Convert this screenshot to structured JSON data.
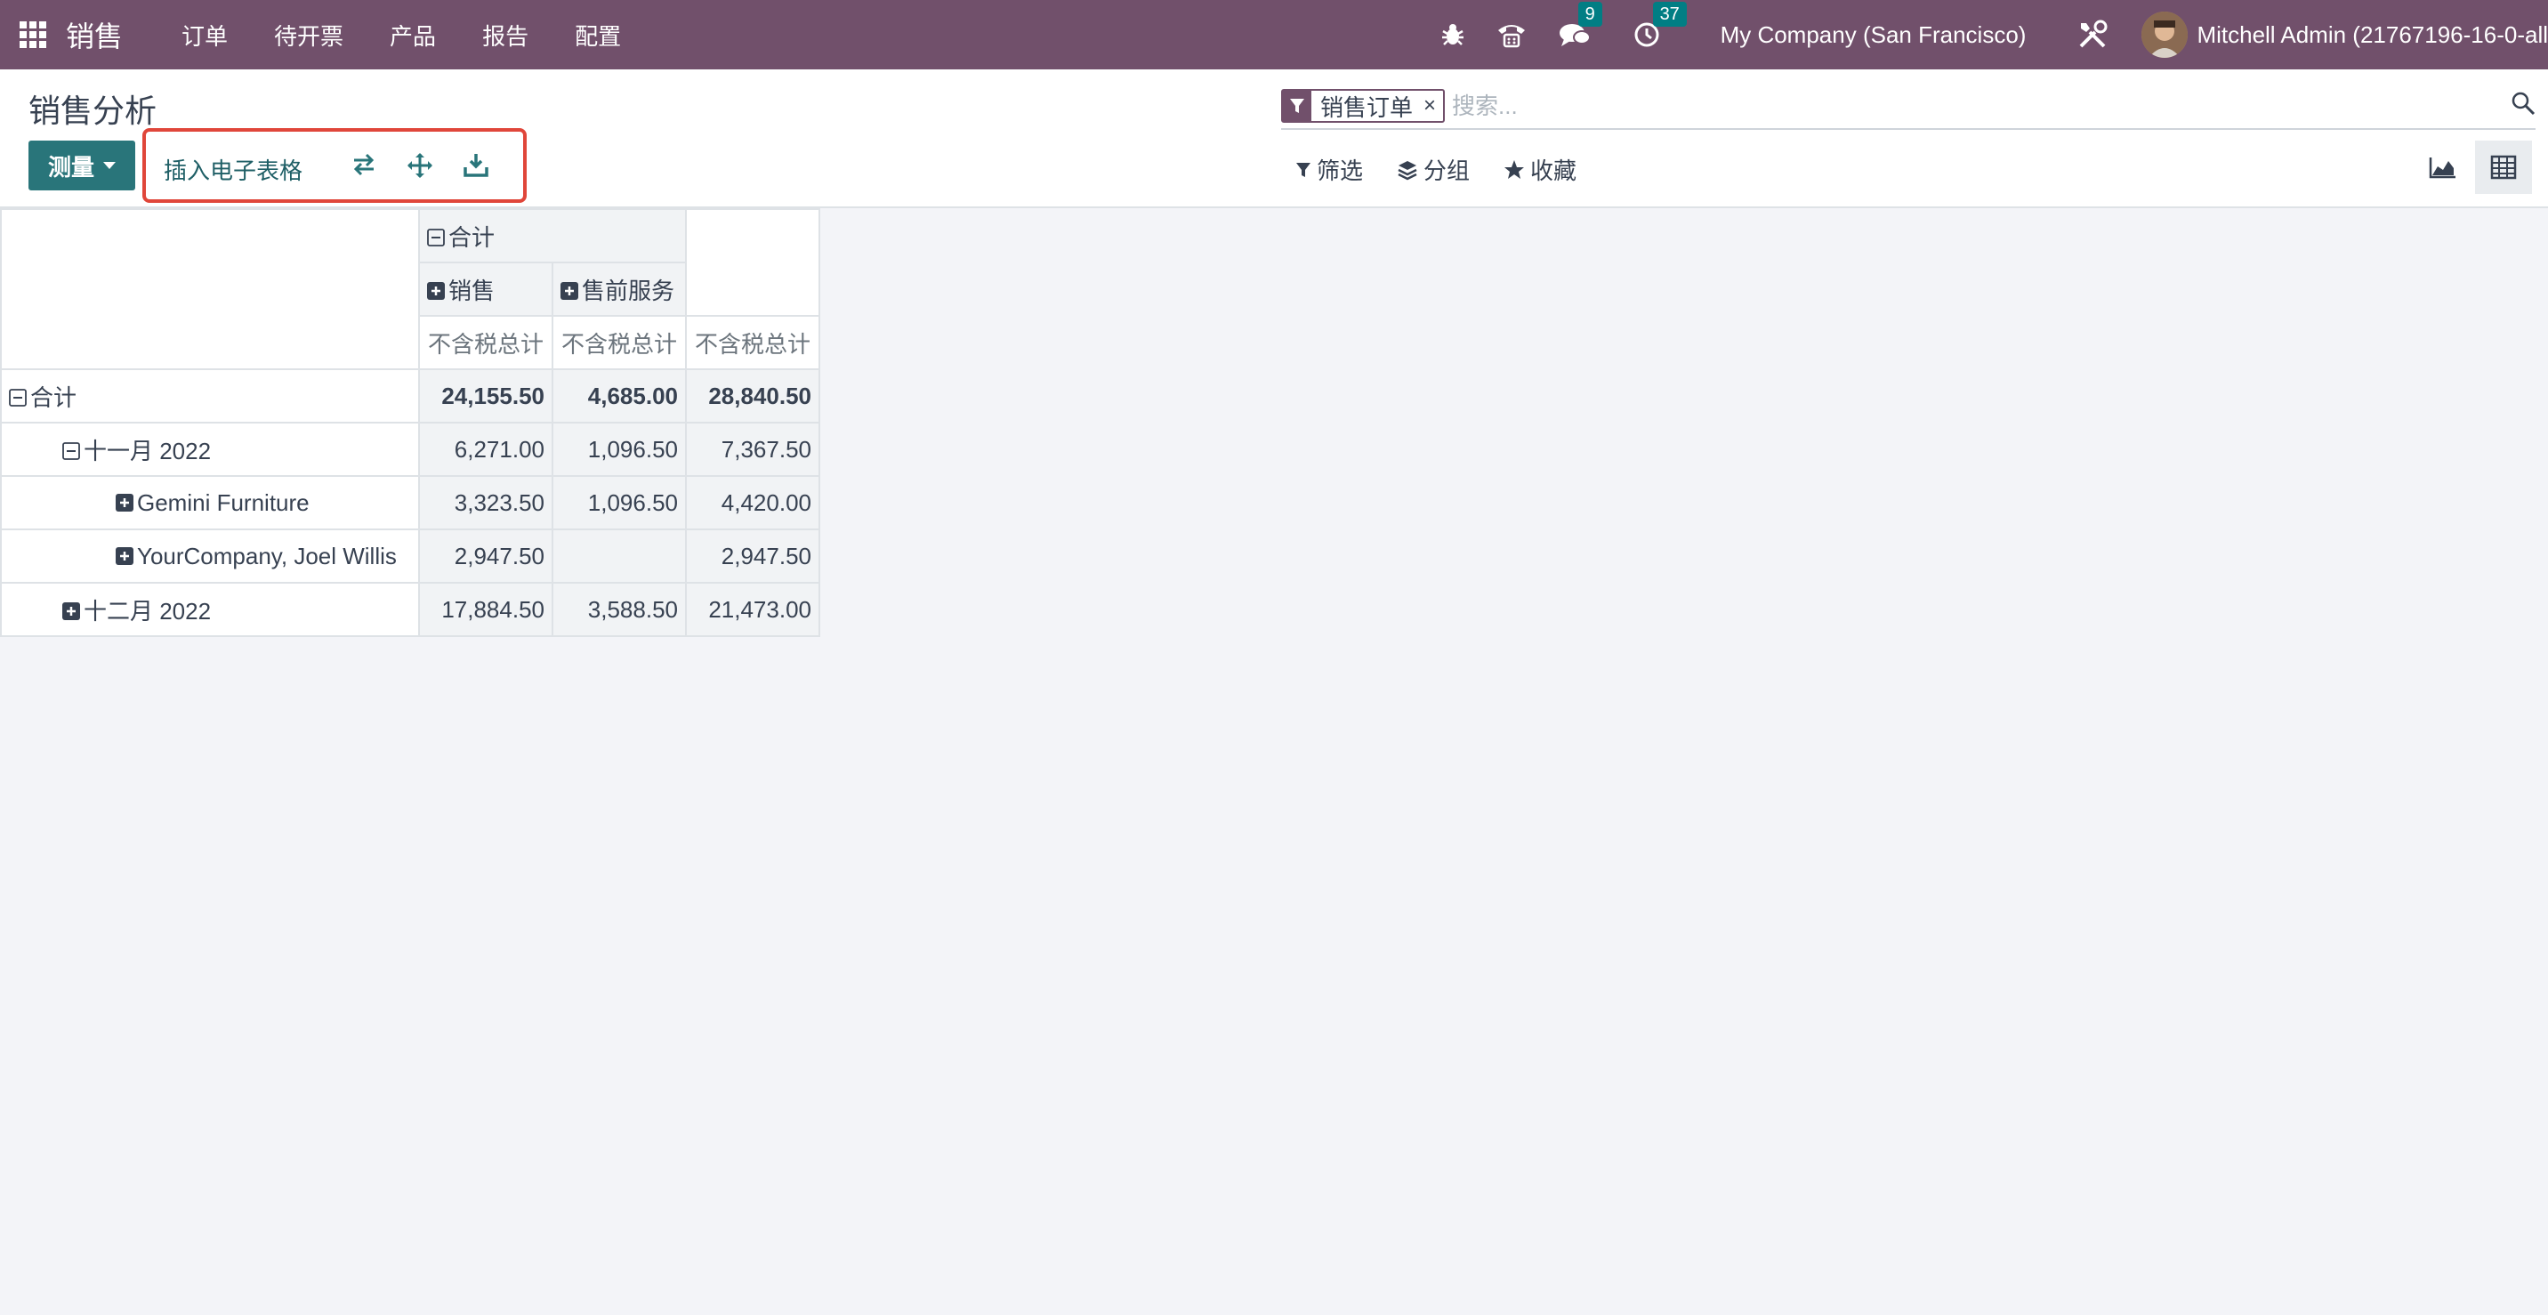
{
  "navbar": {
    "brand": "销售",
    "menu": [
      "订单",
      "待开票",
      "产品",
      "报告",
      "配置"
    ],
    "messages_count": "9",
    "activities_count": "37",
    "company": "My Company (San Francisco)",
    "user": "Mitchell Admin (21767196-16-0-all",
    "bg_color": "#71506b"
  },
  "control": {
    "title": "销售分析",
    "measure_label": "测量",
    "insert_sheet_label": "插入电子表格",
    "facet_label": "销售订单",
    "facet_close": "×",
    "search_placeholder": "搜索...",
    "filter_label": "筛选",
    "group_label": "分组",
    "favorite_label": "收藏",
    "accent_color": "#29757a"
  },
  "pivot": {
    "col_total": "合计",
    "col_groups": [
      "销售",
      "售前服务"
    ],
    "measure": "不含税总计",
    "rows": [
      {
        "label": "合计",
        "values": [
          "24,155.50",
          "4,685.00",
          "28,840.50"
        ]
      },
      {
        "label": "十一月 2022",
        "values": [
          "6,271.00",
          "1,096.50",
          "7,367.50"
        ]
      },
      {
        "label": "Gemini Furniture",
        "values": [
          "3,323.50",
          "1,096.50",
          "4,420.00"
        ]
      },
      {
        "label": "YourCompany, Joel Willis",
        "values": [
          "2,947.50",
          "",
          "2,947.50"
        ]
      },
      {
        "label": "十二月 2022",
        "values": [
          "17,884.50",
          "3,588.50",
          "21,473.00"
        ]
      }
    ]
  }
}
